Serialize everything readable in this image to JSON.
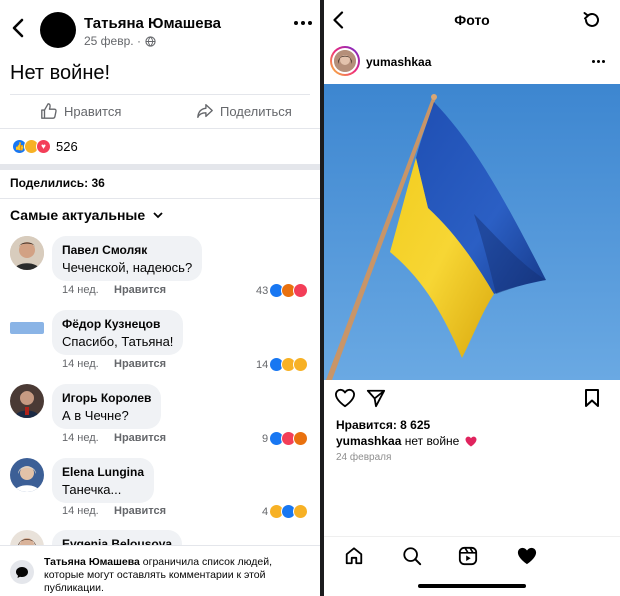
{
  "facebook": {
    "header": {
      "author": "Татьяна Юмашева",
      "date": "25 февр. ·",
      "globe_icon": "globe-icon"
    },
    "post_text": "Нет войне!",
    "actions": {
      "like": "Нравится",
      "share": "Поделиться"
    },
    "reactions_count": "526",
    "shares": "Поделились: 36",
    "sort_label": "Самые актуальные",
    "comments": [
      {
        "name": "Павел Смоляк",
        "text": "Чеченской, надеюсь?",
        "time": "14 нед.",
        "like": "Нравится",
        "count": "43"
      },
      {
        "name": "Фёдор Кузнецов",
        "text": "Спасибо, Татьяна!",
        "time": "14 нед.",
        "like": "Нравится",
        "count": "14"
      },
      {
        "name": "Игорь Королев",
        "text": "А в Чечне?",
        "time": "14 нед.",
        "like": "Нравится",
        "count": "9"
      },
      {
        "name": "Elena Lungina",
        "text": "Танечка...",
        "time": "14 нед.",
        "like": "Нравится",
        "count": "4"
      },
      {
        "name": "Evgenia Belousova",
        "text": "",
        "time": "",
        "like": "",
        "count": ""
      }
    ],
    "footer_author": "Татьяна Юмашева",
    "footer_text_1": " ограничила список людей,",
    "footer_text_2": "которые могут оставлять комментарии к этой",
    "footer_text_3": "публикации."
  },
  "instagram": {
    "title": "Фото",
    "username": "yumashkaa",
    "likes": "Нравится: 8 625",
    "caption_user": "yumashkaa",
    "caption_text": " нет войне ",
    "date": "24 февраля",
    "colors": {
      "flag_blue": "#0057b7",
      "flag_yellow": "#ffd700",
      "sky": "#4a8fd4"
    }
  }
}
